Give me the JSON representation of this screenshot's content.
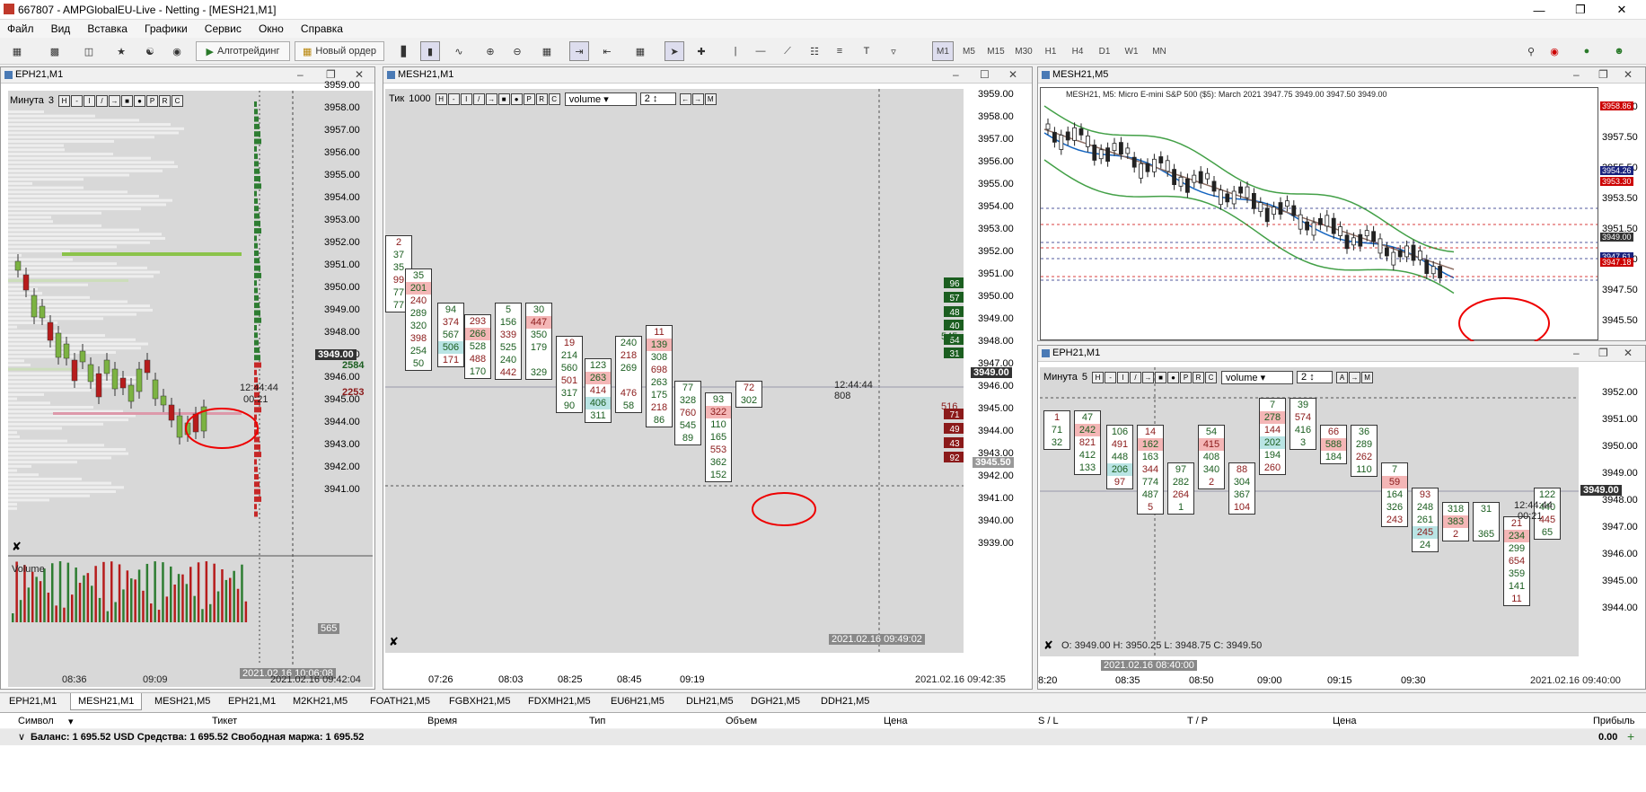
{
  "titlebar": {
    "title": "667807 - AMPGlobalEU-Live - Netting - [MESH21,M1]"
  },
  "menu": [
    "Файл",
    "Вид",
    "Вставка",
    "Графики",
    "Сервис",
    "Окно",
    "Справка"
  ],
  "toolbar": {
    "algo": "Алготрейдинг",
    "new_order": "Новый ордер",
    "timeframes": [
      "M1",
      "M5",
      "M15",
      "M30",
      "H1",
      "H4",
      "D1",
      "W1",
      "MN"
    ],
    "active_tf": "M1"
  },
  "win1": {
    "title": "EPH21,M1",
    "setting": "Минута",
    "setting_val": "3",
    "prices": [
      "3959.00",
      "3958.00",
      "3957.00",
      "3956.00",
      "3955.00",
      "3954.00",
      "3953.00",
      "3952.00",
      "3951.00",
      "3950.00",
      "3949.00",
      "3948.00",
      "3947.00",
      "3946.00",
      "3945.00",
      "3944.00",
      "3943.00",
      "3942.00",
      "3941.00"
    ],
    "current": "3949.00",
    "ask_vol": "2584",
    "bid_vol": "2253",
    "clock": "12:44:44",
    "countdown": "00:21",
    "volume_label": "Volume",
    "volume_value": "565",
    "date_label": "2021.02.16 10:06:08",
    "x_labels": [
      "08:36",
      "09:09"
    ],
    "bottom_date": "2021.02.16 09:42:04"
  },
  "win2": {
    "title": "MESH21,M1",
    "setting": "Тик",
    "setting_val": "1000",
    "select": "volume",
    "select_num": "2",
    "prices": [
      "3959.00",
      "3958.00",
      "3957.00",
      "3956.00",
      "3955.00",
      "3954.00",
      "3953.00",
      "3952.00",
      "3951.00",
      "3950.00",
      "3949.00",
      "3948.00",
      "3947.00",
      "3946.00",
      "3945.00",
      "3944.00",
      "3943.00",
      "3942.00",
      "3941.00",
      "3940.00",
      "3939.00"
    ],
    "current": "3949.00",
    "crosshair": "3945.50",
    "clock": "12:44:44",
    "count": "808",
    "ask_levels": [
      "96",
      "57",
      "48",
      "40",
      "54",
      "31"
    ],
    "ask_total": "545",
    "bid_levels": [
      "71",
      "49",
      "43",
      "92"
    ],
    "bid_total": "516",
    "x_labels": [
      "07:26",
      "08:03",
      "08:25",
      "08:45",
      "09:19"
    ],
    "date_label": "2021.02.16 09:49:02",
    "bottom_date": "2021.02.16 09:42:35",
    "columns": [
      {
        "top": [
          "2",
          "37",
          "35",
          "99",
          "77",
          "77"
        ]
      },
      {
        "top": [
          "35",
          "201",
          "240",
          "289",
          "320",
          "398",
          "254",
          "50"
        ]
      },
      {
        "top": [
          "94",
          "374",
          "567",
          "506",
          "171"
        ]
      },
      {
        "top": [
          "293",
          "266",
          "528",
          "488",
          "170"
        ]
      },
      {
        "top": [
          "5",
          "156",
          "339",
          "525",
          "240",
          "442"
        ]
      },
      {
        "top": [
          "30",
          "447",
          "350",
          "179",
          "",
          "329"
        ]
      },
      {
        "top": [
          "19",
          "214",
          "560",
          "501",
          "317",
          "90"
        ]
      },
      {
        "top": [
          "123",
          "263",
          "414",
          "406",
          "311"
        ]
      },
      {
        "top": [
          "240",
          "218",
          "269",
          "",
          "476",
          "58"
        ]
      },
      {
        "top": [
          "11",
          "139",
          "308",
          "698",
          "263",
          "175",
          "218",
          "86"
        ]
      },
      {
        "top": [
          "77",
          "328",
          "760",
          "545",
          "89"
        ]
      },
      {
        "top": [
          "93",
          "322",
          "110",
          "165",
          "553",
          "362",
          "152"
        ]
      },
      {
        "top": [
          "72",
          "302"
        ]
      }
    ]
  },
  "win3": {
    "title": "MESH21,M5",
    "header": "MESH21, M5:  Micro E-mini S&P 500 ($5): March 2021  3947.75 3949.00 3947.50 3949.00",
    "prices": [
      "3959.50",
      "3957.50",
      "3955.50",
      "3953.50",
      "3951.50",
      "3949.50",
      "3947.50",
      "3945.50"
    ],
    "tags": [
      "3958.86",
      "3954.26",
      "3953.30",
      "3949.00",
      "3947.61",
      "3947.18"
    ]
  },
  "win4": {
    "title": "EPH21,M1",
    "setting": "Минута",
    "setting_val": "5",
    "select": "volume",
    "select_num": "2",
    "prices": [
      "3952.00",
      "3951.00",
      "3950.00",
      "3949.00",
      "3948.00",
      "3947.00",
      "3946.00",
      "3945.00",
      "3944.00"
    ],
    "current": "3949.00",
    "clock": "12:44:44",
    "countdown": "00:21",
    "ohlc": "O: 3949.00   H: 3950.25   L: 3948.75   C: 3949.50",
    "x_labels": [
      "8:20",
      "08:35",
      "08:50",
      "09:00",
      "09:15",
      "09:30"
    ],
    "date_label": "2021.02.16 08:40:00",
    "bottom_date": "2021.02.16 09:40:00",
    "columns": [
      {
        "top": [
          "1",
          "71",
          "32"
        ]
      },
      {
        "top": [
          "47",
          "242",
          "821",
          "412",
          "133"
        ]
      },
      {
        "top": [
          "106",
          "491",
          "448",
          "206",
          "97"
        ]
      },
      {
        "top": [
          "14",
          "162",
          "163",
          "344",
          "774",
          "487",
          "5"
        ]
      },
      {
        "top": [
          "97",
          "282",
          "264",
          "1"
        ]
      },
      {
        "top": [
          "54",
          "415",
          "408",
          "340",
          "2"
        ]
      },
      {
        "top": [
          "88",
          "304",
          "367",
          "104"
        ]
      },
      {
        "top": [
          "7",
          "278",
          "144",
          "202",
          "194",
          "260"
        ]
      },
      {
        "top": [
          "39",
          "574",
          "416",
          "3"
        ]
      },
      {
        "top": [
          "66",
          "588",
          "184"
        ]
      },
      {
        "top": [
          "36",
          "289",
          "262",
          "110"
        ]
      },
      {
        "top": [
          "7",
          "59",
          "164",
          "326",
          "243"
        ]
      },
      {
        "top": [
          "93",
          "248",
          "261",
          "245",
          "24"
        ]
      },
      {
        "top": [
          "318",
          "383",
          "2"
        ]
      },
      {
        "top": [
          "31",
          "",
          "365"
        ]
      },
      {
        "top": [
          "21",
          "234",
          "299",
          "654",
          "359",
          "141",
          "11"
        ]
      },
      {
        "top": [
          "122",
          "440",
          "445",
          "65"
        ]
      }
    ]
  },
  "bottom_tabs": [
    "EPH21,M1",
    "MESH21,M1",
    "MESH21,M5",
    "EPH21,M1",
    "M2KH21,M5",
    "FOATH21,M5",
    "FGBXH21,M5",
    "FDXMH21,M5",
    "EU6H21,M5",
    "DLH21,M5",
    "DGH21,M5",
    "DDH21,M5"
  ],
  "active_tab": "MESH21,M1",
  "terminal": {
    "headers": [
      "Символ",
      "Тикет",
      "Время",
      "Тип",
      "Объем",
      "Цена",
      "S / L",
      "T / P",
      "Цена",
      "Прибыль"
    ],
    "balance": "Баланс: 1 695.52 USD  Средства: 1 695.52  Свободная маржа: 1 695.52",
    "profit": "0.00"
  }
}
